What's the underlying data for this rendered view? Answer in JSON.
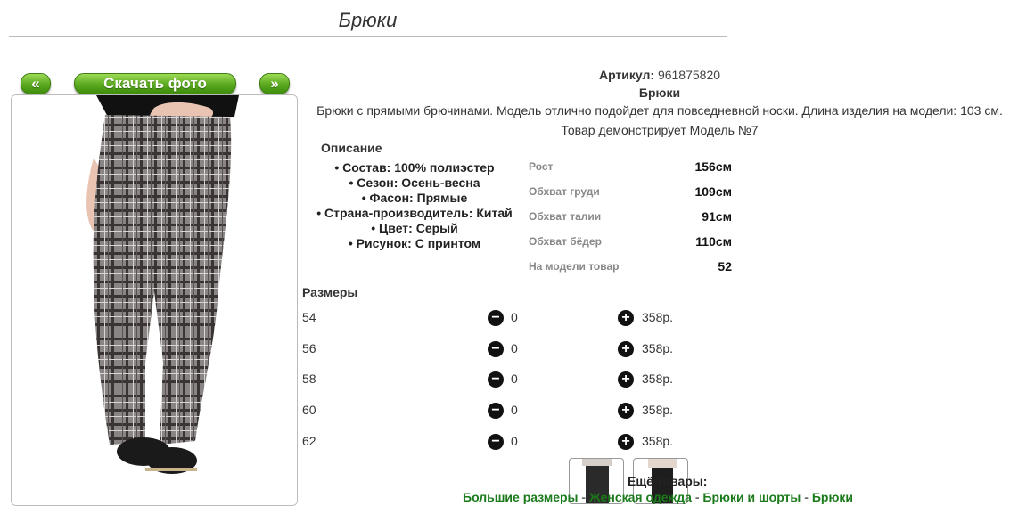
{
  "page": {
    "title": "Брюки"
  },
  "nav": {
    "prev_label": "«",
    "download_label": "Скачать фото",
    "next_label": "»"
  },
  "product": {
    "article_label": "Артикул:",
    "article_value": "961875820",
    "name": "Брюки",
    "description": "Брюки с прямыми брючинами. Модель отлично подойдет для повседневной носки. Длина изделия на модели: 103 см.",
    "model_note": "Товар демонстрирует Модель №7",
    "description_title": "Описание",
    "features": [
      "• Состав: 100% полиэстер",
      "• Сезон: Осень-весна",
      "• Фасон: Прямые",
      "• Страна-производитель: Китай",
      "• Цвет: Серый",
      "• Рисунок: С принтом"
    ],
    "measurements": [
      {
        "label": "Рост",
        "value": "156см"
      },
      {
        "label": "Обхват груди",
        "value": "109см"
      },
      {
        "label": "Обхват талии",
        "value": "91см"
      },
      {
        "label": "Обхват бёдер",
        "value": "110см"
      },
      {
        "label": "На модели товар",
        "value": "52"
      }
    ]
  },
  "sizes": {
    "title": "Размеры",
    "items": [
      {
        "size": "54",
        "qty": "0",
        "price": "358р."
      },
      {
        "size": "56",
        "qty": "0",
        "price": "358р."
      },
      {
        "size": "58",
        "qty": "0",
        "price": "358р."
      },
      {
        "size": "60",
        "qty": "0",
        "price": "358р."
      },
      {
        "size": "62",
        "qty": "0",
        "price": "358р."
      }
    ],
    "minus_symbol": "−",
    "plus_symbol": "+"
  },
  "more": {
    "title": "Ещё товары:",
    "links": [
      "Большие размеры",
      "Женская одежда",
      "Брюки и шорты",
      "Брюки"
    ],
    "separator": "-"
  },
  "icons": {
    "minus": "minus-circle-icon",
    "plus": "plus-circle-icon"
  },
  "colors": {
    "button_green": "#59a81e",
    "link_green": "#1b7a1b"
  }
}
